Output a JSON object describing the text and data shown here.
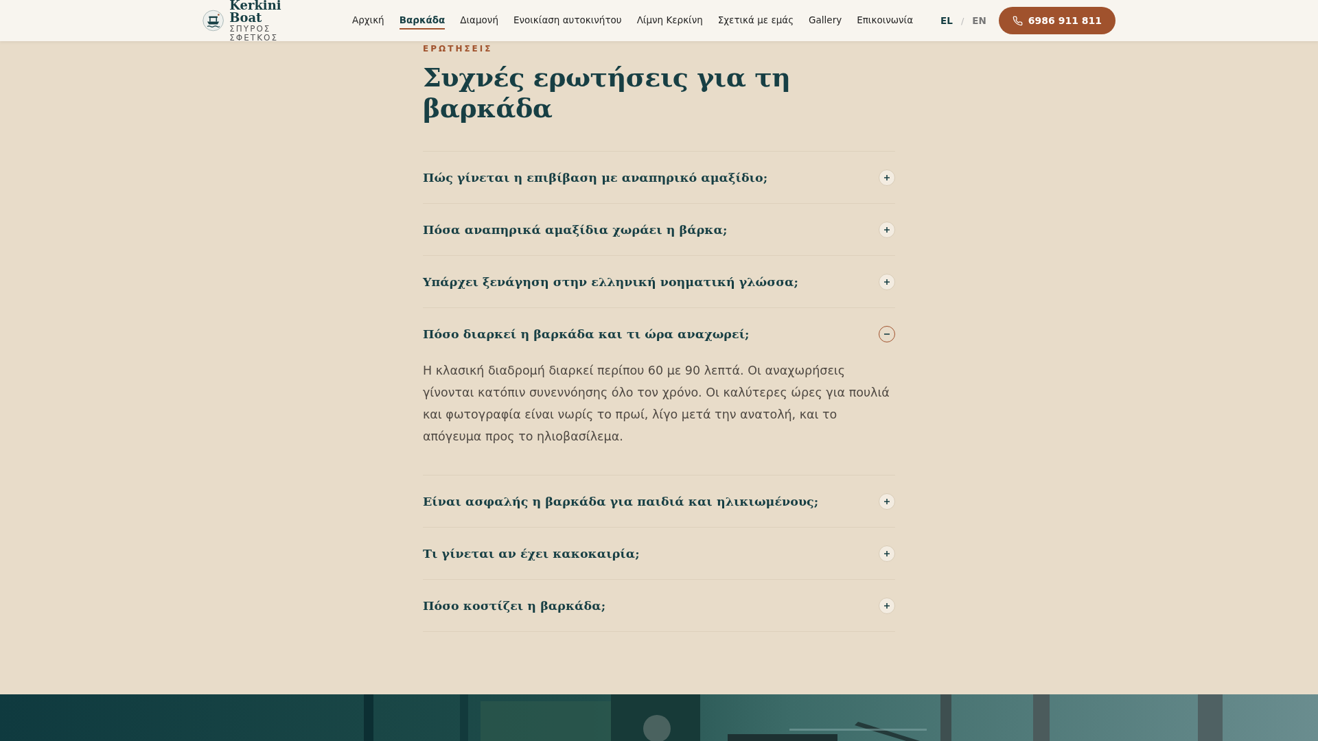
{
  "header": {
    "logo": {
      "name": "Kerkini Boat",
      "subtitle": "ΣΠΥΡΟΣ ΣΦΕΤΚΟΣ"
    },
    "nav": [
      {
        "label": "Αρχική",
        "selected": false
      },
      {
        "label": "Βαρκάδα",
        "selected": true
      },
      {
        "label": "Διαμονή",
        "selected": false
      },
      {
        "label": "Ενοικίαση αυτοκινήτου",
        "selected": false
      },
      {
        "label": "Λίμνη Κερκίνη",
        "selected": false
      },
      {
        "label": "Σχετικά με εμάς",
        "selected": false
      },
      {
        "label": "Gallery",
        "selected": false
      },
      {
        "label": "Επικοινωνία",
        "selected": false
      }
    ],
    "languages": [
      {
        "label": "EL",
        "selected": true
      },
      {
        "label": "EN",
        "selected": false
      }
    ],
    "language_separator": "/",
    "phone_button": "6986 911 811"
  },
  "faq": {
    "eyebrow": "ΕΡΩΤΗΣΕΙΣ",
    "title": "Συχνές ερωτήσεις για τη βαρκάδα",
    "items": [
      {
        "question": "Πώς γίνεται η επιβίβαση με αναπηρικό αμαξίδιο;",
        "expanded": false
      },
      {
        "question": "Πόσα αναπηρικά αμαξίδια χωράει η βάρκα;",
        "expanded": false
      },
      {
        "question": "Υπάρχει ξενάγηση στην ελληνική νοηματική γλώσσα;",
        "expanded": false
      },
      {
        "question": "Πόσο διαρκεί η βαρκάδα και τι ώρα αναχωρεί;",
        "expanded": true,
        "answer": "Η κλασική διαδρομή διαρκεί περίπου 60 με 90 λεπτά. Οι αναχωρήσεις γίνονται κατόπιν συνεννόησης όλο τον χρόνο. Οι καλύτερες ώρες για πουλιά και φωτογραφία είναι νωρίς το πρωί, λίγο μετά την ανατολή, και το απόγευμα προς το ηλιοβασίλεμα."
      },
      {
        "question": "Είναι ασφαλής η βαρκάδα για παιδιά και ηλικιωμένους;",
        "expanded": false
      },
      {
        "question": "Τι γίνεται αν έχει κακοκαιρία;",
        "expanded": false
      },
      {
        "question": "Πόσο κοστίζει η βαρκάδα;",
        "expanded": false
      }
    ]
  }
}
